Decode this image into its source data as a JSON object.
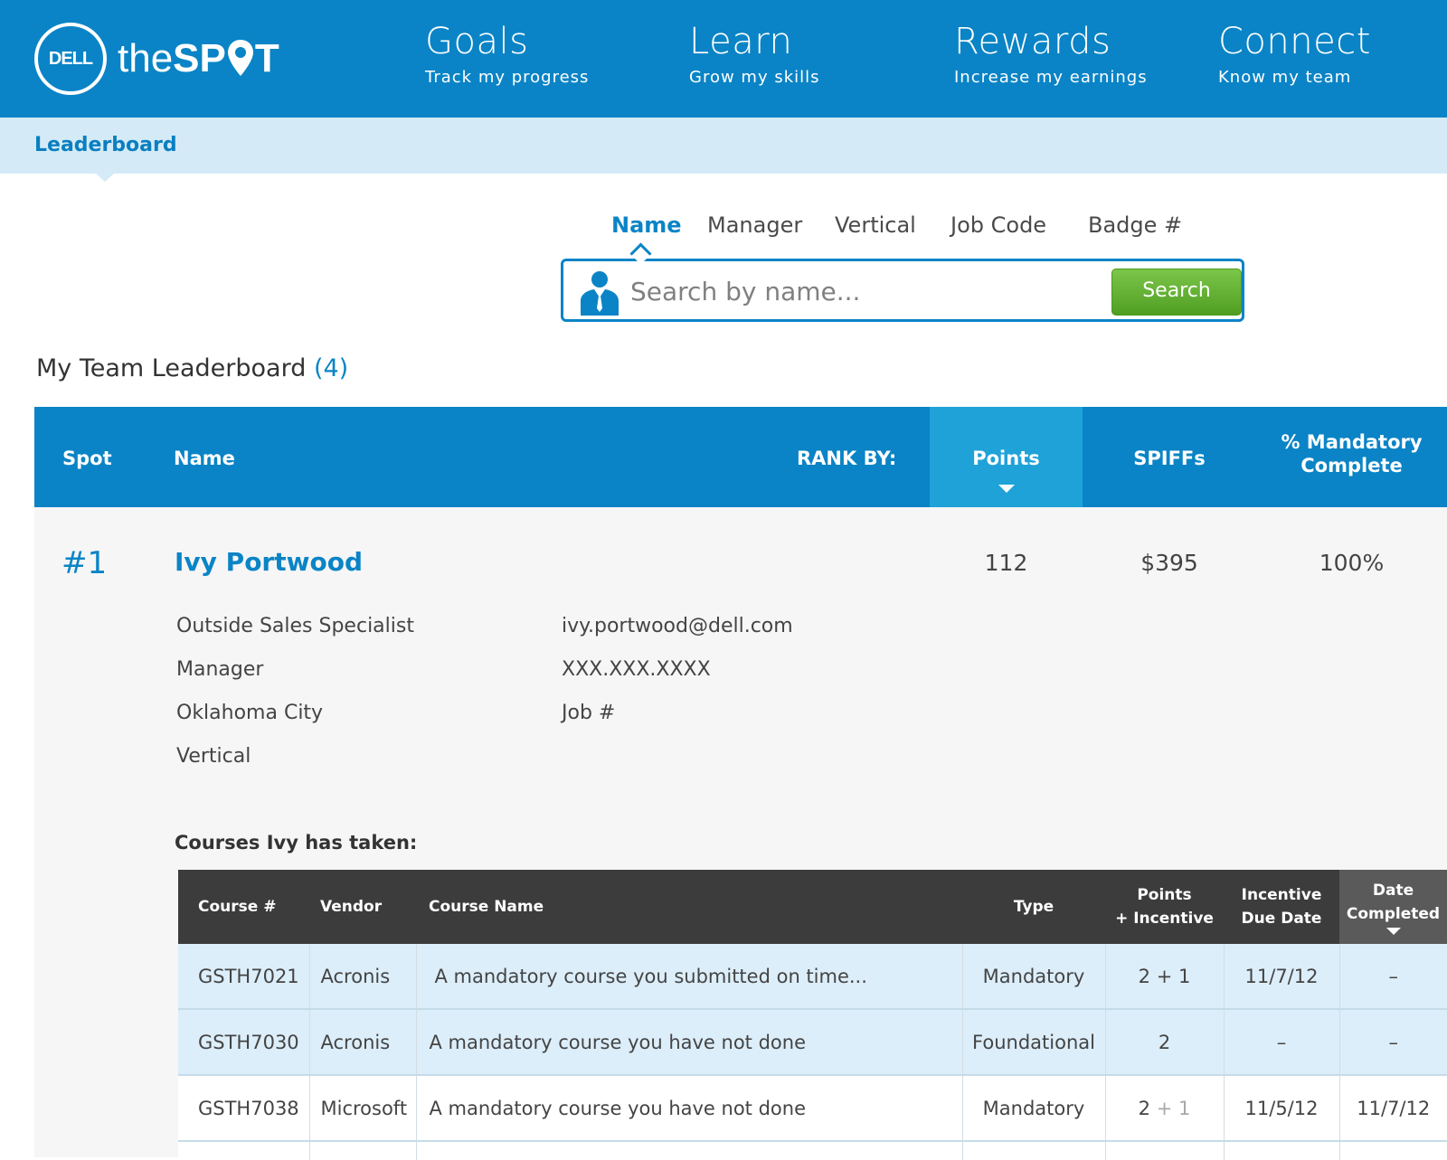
{
  "brand": {
    "logo_text": "DELL",
    "name_light": "the",
    "name_bold_1": "SP",
    "name_bold_2": "T"
  },
  "nav": [
    {
      "title": "Goals",
      "subtitle": "Track my progress"
    },
    {
      "title": "Learn",
      "subtitle": "Grow my skills"
    },
    {
      "title": "Rewards",
      "subtitle": "Increase my earnings"
    },
    {
      "title": "Connect",
      "subtitle": "Know my team"
    }
  ],
  "subnav": {
    "title": "Leaderboard"
  },
  "search": {
    "tabs": [
      "Name",
      "Manager",
      "Vertical",
      "Job Code",
      "Badge #"
    ],
    "active_tab": "Name",
    "placeholder": "Search by name...",
    "button_label": "Search"
  },
  "leaderboard": {
    "title": "My Team Leaderboard",
    "count": "(4)",
    "headers": {
      "spot": "Spot",
      "name": "Name",
      "rank_by": "RANK BY:",
      "points": "Points",
      "spiffs": "SPIFFs",
      "mandatory_line1": "% Mandatory",
      "mandatory_line2": "Complete"
    },
    "rows": [
      {
        "rank": "#1",
        "name": "Ivy Portwood",
        "points": "112",
        "spiffs": "$395",
        "mandatory": "100%",
        "title": "Outside Sales Specialist",
        "manager": "Manager",
        "city": "Oklahoma City",
        "vertical": "Vertical",
        "email": "ivy.portwood@dell.com",
        "phone": "XXX.XXX.XXXX",
        "job": "Job #",
        "courses_title": "Courses Ivy has taken:",
        "courses": [
          {
            "course_no": "GSTH7021",
            "vendor": "Acronis",
            "course_name": "A mandatory course you submitted on time...",
            "type": "Mandatory",
            "points": "2 + 1",
            "points_base": "",
            "points_extra": "",
            "due_date": "11/7/12",
            "date_completed": "–"
          },
          {
            "course_no": "GSTH7030",
            "vendor": "Acronis",
            "course_name": "A mandatory course you have not done",
            "type": "Foundational",
            "points": "2",
            "points_base": "",
            "points_extra": "",
            "due_date": "–",
            "date_completed": "–"
          },
          {
            "course_no": "GSTH7038",
            "vendor": "Microsoft",
            "course_name": "A mandatory course you have not done",
            "type": "Mandatory",
            "points": "",
            "points_base": "2",
            "points_extra": "+ 1",
            "due_date": "11/5/12",
            "date_completed": "11/7/12"
          }
        ]
      }
    ]
  },
  "courses_table": {
    "headers": {
      "course_no": "Course #",
      "vendor": "Vendor",
      "course_name": "Course Name",
      "type": "Type",
      "points_line1": "Points",
      "points_line2": "+ Incentive",
      "due_line1": "Incentive",
      "due_line2": "Due Date",
      "completed_line1": "Date",
      "completed_line2": "Completed"
    }
  },
  "colors": {
    "primary": "#0a84c6",
    "header_active": "#1fa2d8",
    "subbar": "#d4ebf7",
    "search_button": "#5aa82a",
    "table_header": "#3c3c3c",
    "row_highlight": "#dceefa",
    "overdue": "#e0483a"
  },
  "icons": [
    "dell-logo-icon",
    "location-pin-icon",
    "person-icon",
    "sort-down-icon"
  ]
}
